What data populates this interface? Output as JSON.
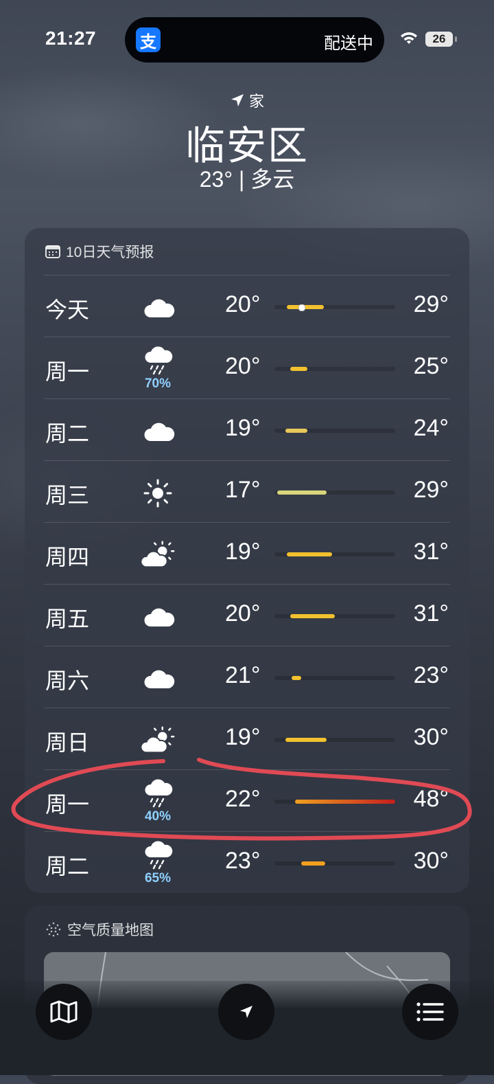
{
  "status_bar": {
    "time": "21:27",
    "island_app_icon": "支",
    "island_text": "配送中",
    "battery": "26"
  },
  "header": {
    "location_label": "家",
    "city": "临安区",
    "current": "23° | 多云"
  },
  "forecast": {
    "title": "10日天气预报",
    "days": [
      {
        "day": "今天",
        "icon": "cloud-icon",
        "precip": "",
        "low": "20°",
        "high": "29°",
        "bar_start": 0.1,
        "bar_end": 0.41,
        "now": 0.22,
        "color": "#f2c12e"
      },
      {
        "day": "周一",
        "icon": "rain-cloud-icon",
        "precip": "70%",
        "low": "20°",
        "high": "25°",
        "bar_start": 0.13,
        "bar_end": 0.27,
        "color": "#f2c12e"
      },
      {
        "day": "周二",
        "icon": "cloud-icon",
        "precip": "",
        "low": "19°",
        "high": "24°",
        "bar_start": 0.09,
        "bar_end": 0.27,
        "color": "#e8c85a"
      },
      {
        "day": "周三",
        "icon": "sun-icon",
        "precip": "",
        "low": "17°",
        "high": "29°",
        "bar_start": 0.02,
        "bar_end": 0.43,
        "color": "#d9d67a"
      },
      {
        "day": "周四",
        "icon": "partly-sunny-icon",
        "precip": "",
        "low": "19°",
        "high": "31°",
        "bar_start": 0.1,
        "bar_end": 0.48,
        "color": "#f2c12e"
      },
      {
        "day": "周五",
        "icon": "cloud-icon",
        "precip": "",
        "low": "20°",
        "high": "31°",
        "bar_start": 0.13,
        "bar_end": 0.5,
        "color": "#f2c12e"
      },
      {
        "day": "周六",
        "icon": "cloud-icon",
        "precip": "",
        "low": "21°",
        "high": "23°",
        "bar_start": 0.14,
        "bar_end": 0.22,
        "color": "#f2c12e"
      },
      {
        "day": "周日",
        "icon": "partly-sunny-icon",
        "precip": "",
        "low": "19°",
        "high": "30°",
        "bar_start": 0.09,
        "bar_end": 0.43,
        "color": "#f2c12e"
      },
      {
        "day": "周一",
        "icon": "rain-cloud-icon",
        "precip": "40%",
        "low": "22°",
        "high": "48°",
        "bar_start": 0.17,
        "bar_end": 1.0,
        "color": "#f0a020",
        "color_end": "#c41e1e"
      },
      {
        "day": "周二",
        "icon": "rain-cloud-icon",
        "precip": "65%",
        "low": "23°",
        "high": "30°",
        "bar_start": 0.22,
        "bar_end": 0.42,
        "color": "#f2a01e"
      }
    ]
  },
  "air_quality": {
    "title": "空气质量地图"
  },
  "toolbar": {
    "map_icon": "map-icon",
    "location_icon": "location-arrow-icon",
    "list_icon": "list-icon"
  }
}
